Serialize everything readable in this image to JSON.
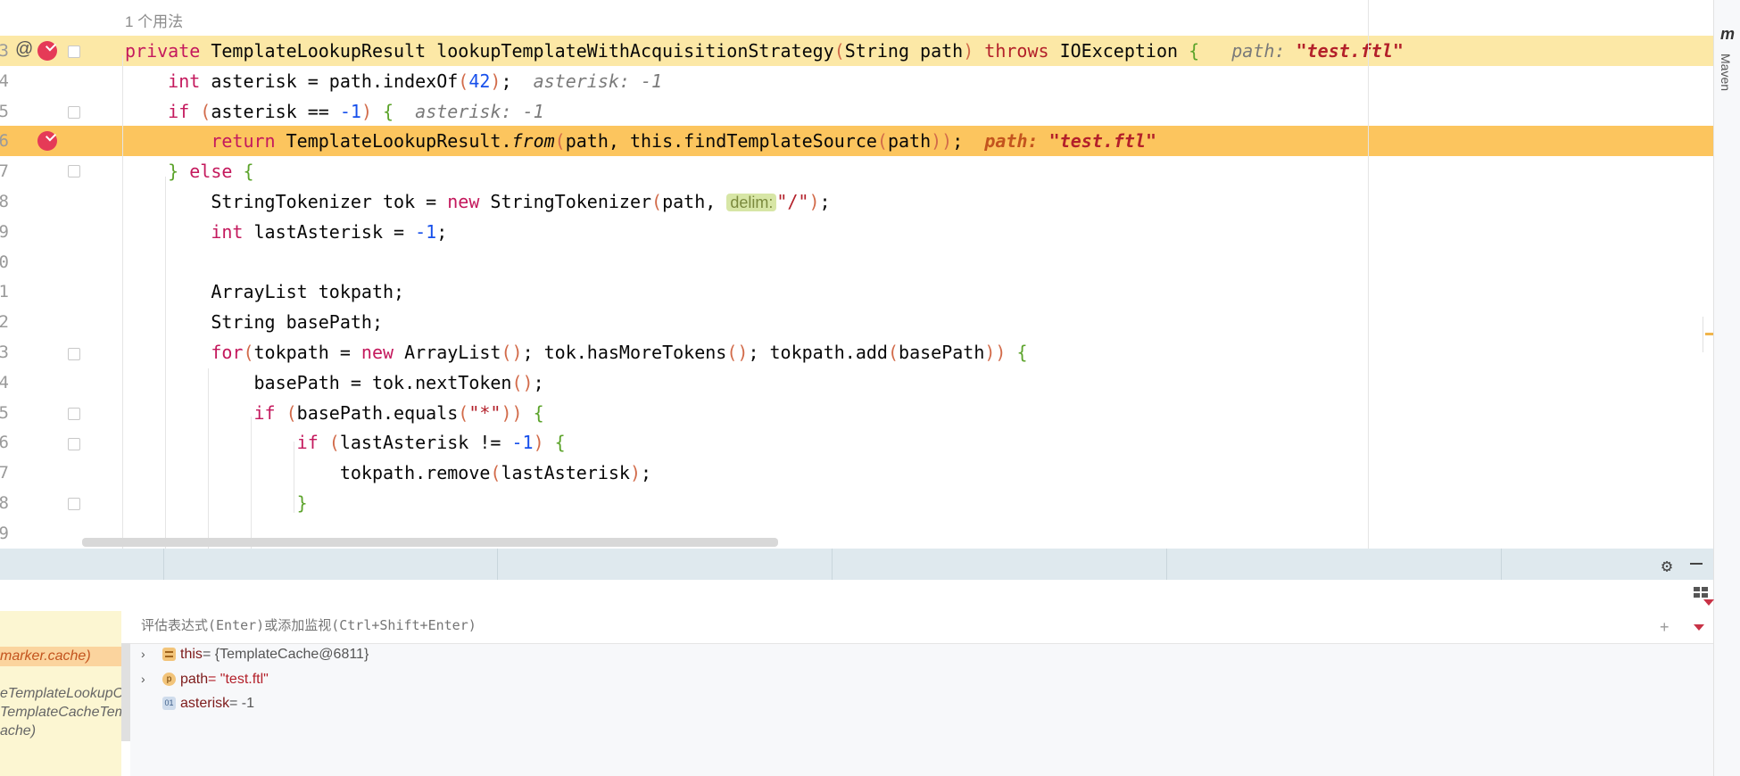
{
  "editor": {
    "usage_hint": "1 个用法",
    "lines": [
      {
        "num": "3",
        "parts": [
          [
            "kw",
            "private "
          ],
          [
            "",
            "TemplateLookupResult lookupTemplateWithAcquisitionStrategy"
          ],
          [
            "par",
            "("
          ],
          [
            "",
            "String path"
          ],
          [
            "par",
            ")"
          ],
          [
            "kwo",
            " throws "
          ],
          [
            "",
            "IOException "
          ],
          [
            "brace",
            "{"
          ],
          [
            "inl",
            "   path: "
          ],
          [
            "dbg-str",
            "\"test.ftl\""
          ]
        ]
      },
      {
        "num": "4",
        "parts": [
          [
            "kw",
            "    int "
          ],
          [
            "",
            "asterisk = path.indexOf"
          ],
          [
            "par",
            "("
          ],
          [
            "num-lit",
            "42"
          ],
          [
            "par",
            ")"
          ],
          [
            "",
            ";"
          ],
          [
            "inl",
            "  asterisk: -1"
          ]
        ]
      },
      {
        "num": "5",
        "parts": [
          [
            "kw",
            "    if "
          ],
          [
            "par",
            "("
          ],
          [
            "",
            "asterisk == "
          ],
          [
            "num-lit",
            "-1"
          ],
          [
            "par",
            ")"
          ],
          [
            "brace",
            " {"
          ],
          [
            "inl",
            "  asterisk: -1"
          ]
        ]
      },
      {
        "num": "6",
        "parts": [
          [
            "kw",
            "        return "
          ],
          [
            "",
            "TemplateLookupResult."
          ],
          [
            "ital",
            "from"
          ],
          [
            "par",
            "("
          ],
          [
            "",
            "path, this.findTemplateSource"
          ],
          [
            "par",
            "("
          ],
          [
            "",
            "path"
          ],
          [
            "par",
            "))"
          ],
          [
            "",
            ";"
          ],
          [
            "dbg-name",
            "  path: "
          ],
          [
            "dbg-str",
            "\"test.ftl\""
          ]
        ]
      },
      {
        "num": "7",
        "parts": [
          [
            "brace",
            "    } "
          ],
          [
            "kw",
            "else "
          ],
          [
            "brace",
            "{"
          ]
        ]
      },
      {
        "num": "8",
        "parts": [
          [
            "",
            "        StringTokenizer tok = "
          ],
          [
            "kw",
            "new "
          ],
          [
            "",
            "StringTokenizer"
          ],
          [
            "par",
            "("
          ],
          [
            "",
            "path, "
          ],
          [
            "hint",
            "delim:"
          ],
          [
            "str",
            "\"/\""
          ],
          [
            "par",
            ")"
          ],
          [
            "",
            ";"
          ]
        ]
      },
      {
        "num": "9",
        "parts": [
          [
            "kw",
            "        int "
          ],
          [
            "",
            "lastAsterisk = "
          ],
          [
            "num-lit",
            "-1"
          ],
          [
            "",
            ";"
          ]
        ]
      },
      {
        "num": "0",
        "parts": []
      },
      {
        "num": "1",
        "parts": [
          [
            "",
            "        ArrayList tokpath;"
          ]
        ]
      },
      {
        "num": "2",
        "parts": [
          [
            "",
            "        String basePath;"
          ]
        ]
      },
      {
        "num": "3",
        "parts": [
          [
            "kw",
            "        for"
          ],
          [
            "par",
            "("
          ],
          [
            "",
            "tokpath = "
          ],
          [
            "kw",
            "new "
          ],
          [
            "",
            "ArrayList"
          ],
          [
            "par",
            "()"
          ],
          [
            "",
            "; tok.hasMoreTokens"
          ],
          [
            "par",
            "()"
          ],
          [
            "",
            "; tokpath.add"
          ],
          [
            "par",
            "("
          ],
          [
            "",
            "basePath"
          ],
          [
            "par",
            "))"
          ],
          [
            "brace",
            " {"
          ]
        ]
      },
      {
        "num": "4",
        "parts": [
          [
            "",
            "            basePath = tok.nextToken"
          ],
          [
            "par",
            "()"
          ],
          [
            "",
            ";"
          ]
        ]
      },
      {
        "num": "5",
        "parts": [
          [
            "kw",
            "            if "
          ],
          [
            "par",
            "("
          ],
          [
            "",
            "basePath.equals"
          ],
          [
            "par",
            "("
          ],
          [
            "str",
            "\"*\""
          ],
          [
            "par",
            "))"
          ],
          [
            "brace",
            " {"
          ]
        ]
      },
      {
        "num": "6",
        "parts": [
          [
            "kw",
            "                if "
          ],
          [
            "par",
            "("
          ],
          [
            "",
            "lastAsterisk != "
          ],
          [
            "num-lit",
            "-1"
          ],
          [
            "par",
            ")"
          ],
          [
            "brace",
            " {"
          ]
        ]
      },
      {
        "num": "7",
        "parts": [
          [
            "",
            "                    tokpath.remove"
          ],
          [
            "par",
            "("
          ],
          [
            "",
            "lastAsterisk"
          ],
          [
            "par",
            ")"
          ],
          [
            "",
            ";"
          ]
        ]
      },
      {
        "num": "8",
        "parts": [
          [
            "brace",
            "                }"
          ]
        ]
      },
      {
        "num": "9",
        "parts": []
      }
    ]
  },
  "sidebar": {
    "maven_label": "Maven",
    "m_icon": "m"
  },
  "debugger": {
    "eval_placeholder": "评估表达式(Enter)或添加监视(Ctrl+Shift+Enter)",
    "frames": [
      {
        "label": "marker.cache)",
        "selected": true
      },
      {
        "label": "",
        "selected": false
      },
      {
        "label": "eTemplateLookupC",
        "selected": false
      },
      {
        "label": "TemplateCacheTem",
        "selected": false
      },
      {
        "label": "ache)",
        "selected": false
      }
    ],
    "variables": [
      {
        "name": "this",
        "value": " = {TemplateCache@6811}",
        "value_color": "#555555",
        "icon": "fields-icon",
        "expandable": true
      },
      {
        "name": "path",
        "value": " = \"test.ftl\"",
        "value_color": "#b3202a",
        "icon": "param-icon",
        "icon_text": "p",
        "expandable": true
      },
      {
        "name": "asterisk",
        "value": " = -1",
        "value_color": "#555555",
        "icon": "primitive-icon",
        "icon_text": "01",
        "expandable": false
      }
    ]
  }
}
